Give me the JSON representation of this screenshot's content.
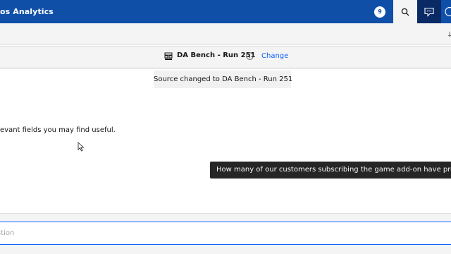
{
  "header": {
    "app_title": "os Analytics",
    "notification_count": "9",
    "colors": {
      "bar": "#0f4fa8",
      "active": "#0a2a66"
    }
  },
  "source": {
    "name": "DA Bench - Run 251",
    "change_label": "Change",
    "icon": "data-module-icon"
  },
  "toast": {
    "message": "Source changed to DA Bench - Run 251"
  },
  "chat": {
    "bot_message": "evant fields you may find useful.",
    "user_message": "How many of our customers subscribing the game add-on have premium t"
  },
  "input": {
    "placeholder": "stion"
  }
}
